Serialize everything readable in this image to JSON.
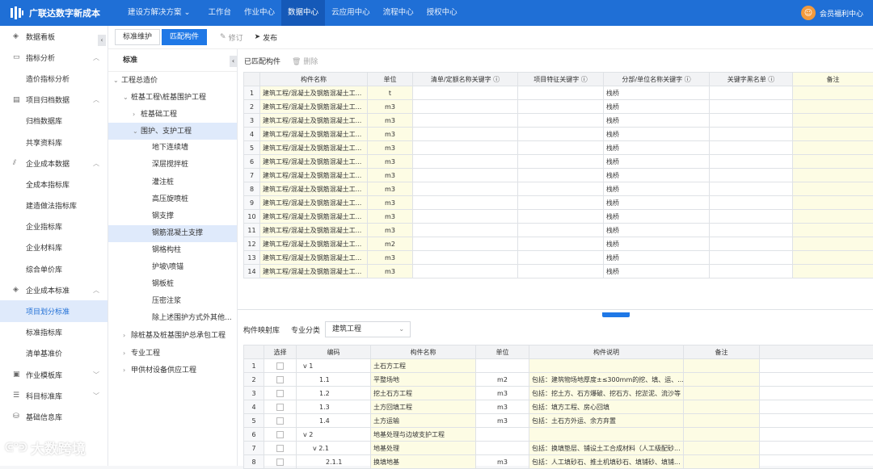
{
  "app": {
    "title": "广联达数字新成本"
  },
  "nav": {
    "solution": "建设方解决方案",
    "items": [
      "工作台",
      "作业中心",
      "数据中心",
      "云应用中心",
      "流程中心",
      "授权中心"
    ],
    "active": "数据中心"
  },
  "user": {
    "name": "会员福利中心"
  },
  "sidebar": [
    {
      "type": "group",
      "label": "数据看板",
      "icon": "layers-icon",
      "arrow": ""
    },
    {
      "type": "group",
      "label": "指标分析",
      "icon": "monitor-icon",
      "arrow": "^"
    },
    {
      "type": "sub",
      "label": "造价指标分析"
    },
    {
      "type": "group",
      "label": "项目归档数据",
      "icon": "archive-icon",
      "arrow": "^"
    },
    {
      "type": "sub",
      "label": "归档数据库"
    },
    {
      "type": "sub",
      "label": "共享资料库"
    },
    {
      "type": "group",
      "label": "企业成本数据",
      "icon": "chart-icon",
      "arrow": "^"
    },
    {
      "type": "sub",
      "label": "全成本指标库"
    },
    {
      "type": "sub",
      "label": "建造做法指标库"
    },
    {
      "type": "sub",
      "label": "企业指标库"
    },
    {
      "type": "sub",
      "label": "企业材料库"
    },
    {
      "type": "sub",
      "label": "综合单价库"
    },
    {
      "type": "group",
      "label": "企业成本标准",
      "icon": "layers-icon",
      "arrow": "^"
    },
    {
      "type": "sub",
      "label": "项目划分标准",
      "active": true
    },
    {
      "type": "sub",
      "label": "标准指标库"
    },
    {
      "type": "sub",
      "label": "清单基准价"
    },
    {
      "type": "group",
      "label": "作业模板库",
      "icon": "template-icon",
      "arrow": "v"
    },
    {
      "type": "group",
      "label": "科目标准库",
      "icon": "list-icon",
      "arrow": "v"
    },
    {
      "type": "group",
      "label": "基础信息库",
      "icon": "database-icon",
      "arrow": ""
    }
  ],
  "tabs": [
    "标准维护",
    "匹配构件"
  ],
  "active_tab": "匹配构件",
  "tools": {
    "edit": "修订",
    "publish": "发布"
  },
  "tree": {
    "header": "标准",
    "nodes": [
      {
        "level": 0,
        "caret": "v",
        "label": "工程总造价"
      },
      {
        "level": 1,
        "caret": "v",
        "label": "桩基工程\\桩基围护工程"
      },
      {
        "level": 2,
        "caret": ">",
        "label": "桩基础工程"
      },
      {
        "level": 2,
        "caret": "v",
        "label": "围护、支护工程",
        "selected": true
      },
      {
        "level": 3,
        "caret": "",
        "label": "地下连续墙"
      },
      {
        "level": 3,
        "caret": "",
        "label": "深层搅拌桩"
      },
      {
        "level": 3,
        "caret": "",
        "label": "灌注桩"
      },
      {
        "level": 3,
        "caret": "",
        "label": "高压旋喷桩"
      },
      {
        "level": 3,
        "caret": "",
        "label": "钢支撑"
      },
      {
        "level": 3,
        "caret": "",
        "label": "钢筋混凝土支撑",
        "selected": true
      },
      {
        "level": 3,
        "caret": "",
        "label": "钢格构柱"
      },
      {
        "level": 3,
        "caret": "",
        "label": "护坡\\喷锚"
      },
      {
        "level": 3,
        "caret": "",
        "label": "钢板桩"
      },
      {
        "level": 3,
        "caret": "",
        "label": "压密注浆"
      },
      {
        "level": 3,
        "caret": "",
        "label": "除上述围护方式外其他..."
      },
      {
        "level": 1,
        "caret": ">",
        "label": "除桩基及桩基围护总承包工程"
      },
      {
        "level": 1,
        "caret": ">",
        "label": "专业工程"
      },
      {
        "level": 1,
        "caret": ">",
        "label": "甲供材设备供应工程"
      }
    ]
  },
  "matched": {
    "title": "已匹配构件",
    "delete_label": "删除",
    "columns": [
      "",
      "构件名称",
      "单位",
      "清单/定额名称关键字",
      "项目特征关键字",
      "分部/单位名称关键字",
      "关键字黑名单",
      "备注"
    ],
    "rows": [
      [
        "1",
        "建筑工程/混凝土及钢筋混凝土工...",
        "t",
        "",
        "",
        "栈桥",
        "",
        ""
      ],
      [
        "2",
        "建筑工程/混凝土及钢筋混凝土工...",
        "m3",
        "",
        "",
        "栈桥",
        "",
        ""
      ],
      [
        "3",
        "建筑工程/混凝土及钢筋混凝土工...",
        "m3",
        "",
        "",
        "栈桥",
        "",
        ""
      ],
      [
        "4",
        "建筑工程/混凝土及钢筋混凝土工...",
        "m3",
        "",
        "",
        "栈桥",
        "",
        ""
      ],
      [
        "5",
        "建筑工程/混凝土及钢筋混凝土工...",
        "m3",
        "",
        "",
        "栈桥",
        "",
        ""
      ],
      [
        "6",
        "建筑工程/混凝土及钢筋混凝土工...",
        "m3",
        "",
        "",
        "栈桥",
        "",
        ""
      ],
      [
        "7",
        "建筑工程/混凝土及钢筋混凝土工...",
        "m3",
        "",
        "",
        "栈桥",
        "",
        ""
      ],
      [
        "8",
        "建筑工程/混凝土及钢筋混凝土工...",
        "m3",
        "",
        "",
        "栈桥",
        "",
        ""
      ],
      [
        "9",
        "建筑工程/混凝土及钢筋混凝土工...",
        "m3",
        "",
        "",
        "栈桥",
        "",
        ""
      ],
      [
        "10",
        "建筑工程/混凝土及钢筋混凝土工...",
        "m3",
        "",
        "",
        "栈桥",
        "",
        ""
      ],
      [
        "11",
        "建筑工程/混凝土及钢筋混凝土工...",
        "m3",
        "",
        "",
        "栈桥",
        "",
        ""
      ],
      [
        "12",
        "建筑工程/混凝土及钢筋混凝土工...",
        "m2",
        "",
        "",
        "栈桥",
        "",
        ""
      ],
      [
        "13",
        "建筑工程/混凝土及钢筋混凝土工...",
        "m3",
        "",
        "",
        "栈桥",
        "",
        ""
      ],
      [
        "14",
        "建筑工程/混凝土及钢筋混凝土工...",
        "m3",
        "",
        "",
        "栈桥",
        "",
        ""
      ]
    ]
  },
  "library": {
    "title": "构件映射库",
    "category_label": "专业分类",
    "category_value": "建筑工程",
    "columns": [
      "",
      "选择",
      "编码",
      "构件名称",
      "单位",
      "构件说明",
      "备注"
    ],
    "rows": [
      [
        "1",
        "v 1",
        "土石方工程",
        "",
        "",
        ""
      ],
      [
        "2",
        "1.1",
        "平整场地",
        "m2",
        "包括：建筑物场地厚度±≤300mm的挖、填、运、...",
        ""
      ],
      [
        "3",
        "1.2",
        "挖土石方工程",
        "m3",
        "包括：挖土方、石方爆破、挖石方、挖淤泥、流沙等",
        ""
      ],
      [
        "4",
        "1.3",
        "土方回填工程",
        "m3",
        "包括：填方工程、房心回填",
        ""
      ],
      [
        "5",
        "1.4",
        "土方运输",
        "m3",
        "包括：土石方外运、余方弃置",
        ""
      ],
      [
        "6",
        "v 2",
        "地基处理与边坡支护工程",
        "",
        "",
        ""
      ],
      [
        "7",
        "v 2.1",
        "地基处理",
        "",
        "包括：换填垫层、铺设土工合成材料（人工级配砂...",
        ""
      ],
      [
        "8",
        "2.1.1",
        "换填地基",
        "m3",
        "包括：人工填砂石、推土机填砂石、填铺砂、填铺...",
        ""
      ]
    ]
  },
  "watermark": "大数跨境"
}
